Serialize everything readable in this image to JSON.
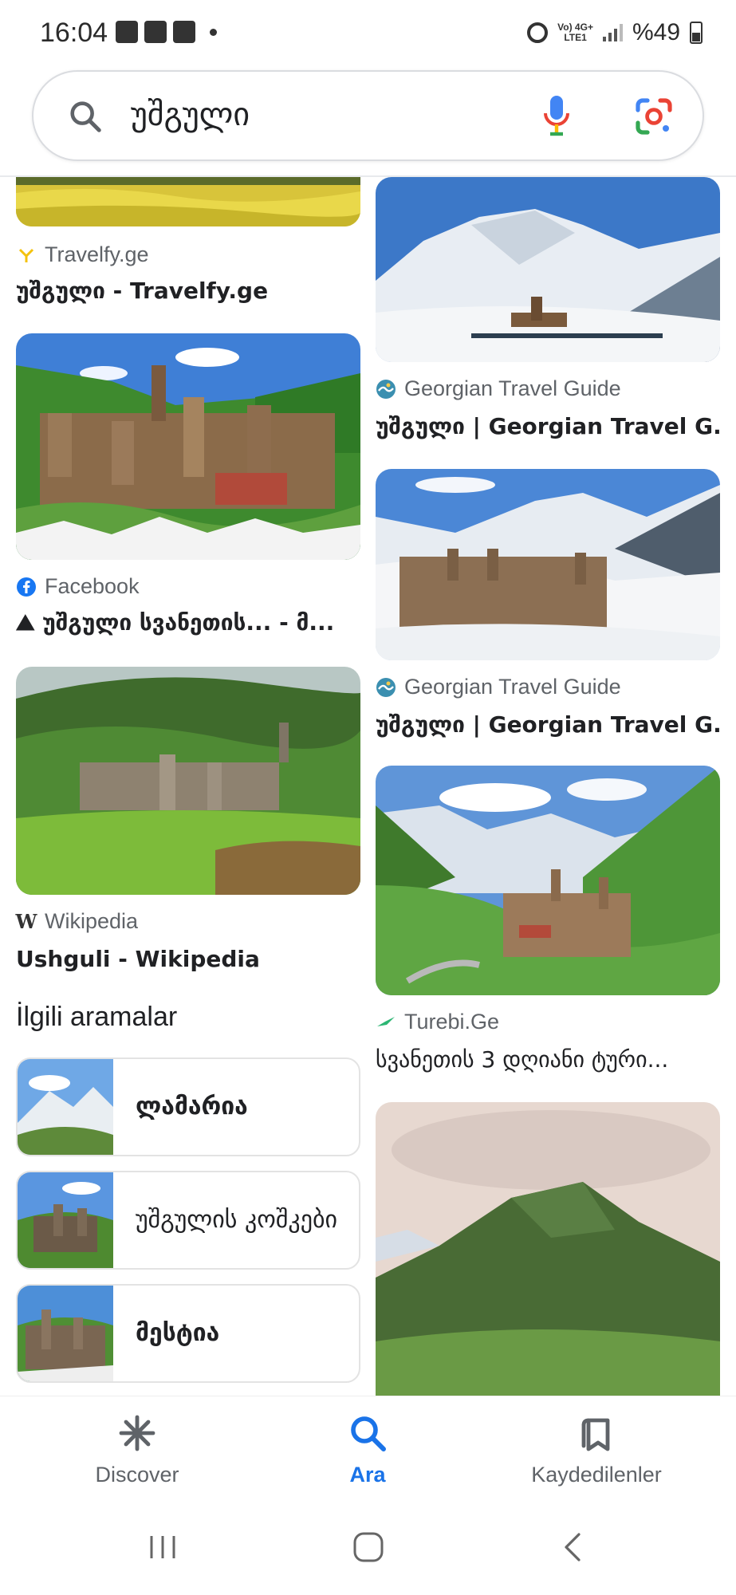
{
  "status_bar": {
    "time": "16:04",
    "network": [
      "Vo) 4G+",
      "LTE1"
    ],
    "battery": "%49"
  },
  "search": {
    "query": "უშგული"
  },
  "results_left": [
    {
      "source": "Travelfy.ge",
      "title": "უშგული - Travelfy.ge",
      "icon": "travelfy-icon"
    },
    {
      "source": "Facebook",
      "title": "⛰ უშგული სვანეთის... - მ...",
      "icon": "facebook-icon"
    },
    {
      "source": "Wikipedia",
      "title": "Ushguli - Wikipedia",
      "icon": "wikipedia-icon"
    }
  ],
  "results_right": [
    {
      "source": "Georgian Travel Guide",
      "title": "უშგული | Georgian Travel G...",
      "icon": "georgian-travel-guide-icon"
    },
    {
      "source": "Georgian Travel Guide",
      "title": "უშგული | Georgian Travel G...",
      "icon": "georgian-travel-guide-icon"
    },
    {
      "source": "Turebi.Ge",
      "title": "სვანეთის 3 დღიანი ტური...",
      "icon": "turebi-icon"
    }
  ],
  "related": {
    "heading": "İlgili aramalar",
    "items": [
      {
        "label": "ლამარია",
        "bold": true
      },
      {
        "label": "უშგულის კოშკები",
        "bold": false
      },
      {
        "label": "მესტია",
        "bold": true
      }
    ]
  },
  "bottom_nav": {
    "items": [
      {
        "label": "Discover",
        "icon": "asterisk-icon",
        "active": false
      },
      {
        "label": "Ara",
        "icon": "search-icon",
        "active": true
      },
      {
        "label": "Kaydedilenler",
        "icon": "bookmarks-icon",
        "active": false
      }
    ]
  },
  "colors": {
    "accent": "#1a73e8",
    "facebook": "#1877f2",
    "travelfy": "#f4c20d",
    "turebi": "#2bb673"
  }
}
